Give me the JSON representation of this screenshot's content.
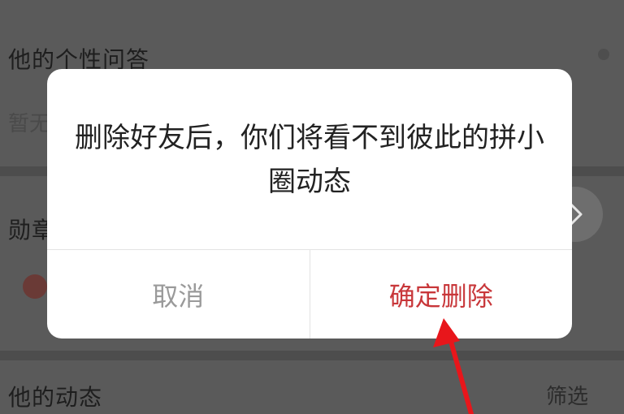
{
  "background": {
    "qa_title": "他的个性问答",
    "qa_placeholder": "暂无",
    "medal_title": "勋章",
    "feed_title": "他的动态",
    "filter_label": "筛选"
  },
  "dialog": {
    "message": "删除好友后，你们将看不到彼此的拼小圈动态",
    "cancel_label": "取消",
    "confirm_label": "确定删除"
  },
  "icons": {
    "side_arrow": "chevron-right-icon",
    "annotation": "red-arrow-annotation"
  },
  "colors": {
    "overlay": "#5a5a5a",
    "dialog_bg": "#ffffff",
    "confirm": "#c8373a",
    "cancel": "#9a9a9a",
    "annotation": "#e8161b"
  }
}
